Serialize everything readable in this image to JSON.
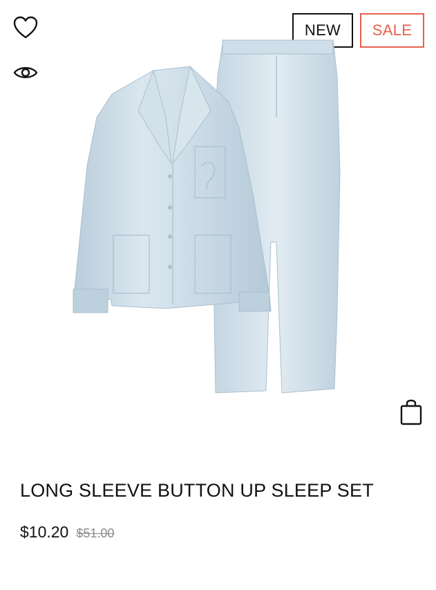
{
  "badges": {
    "new": "NEW",
    "sale": "SALE"
  },
  "icons": {
    "wishlist": "heart-icon",
    "quick_view": "eye-icon",
    "add_to_bag": "shopping-bag-icon"
  },
  "product": {
    "title": "LONG SLEEVE BUTTON UP SLEEP SET",
    "price_sale": "$10.20",
    "price_original": "$51.00",
    "image_color": "#c9d9e4"
  },
  "colors": {
    "sale_accent": "#e8604c",
    "text": "#111111",
    "muted_text": "#8a8a8a"
  }
}
